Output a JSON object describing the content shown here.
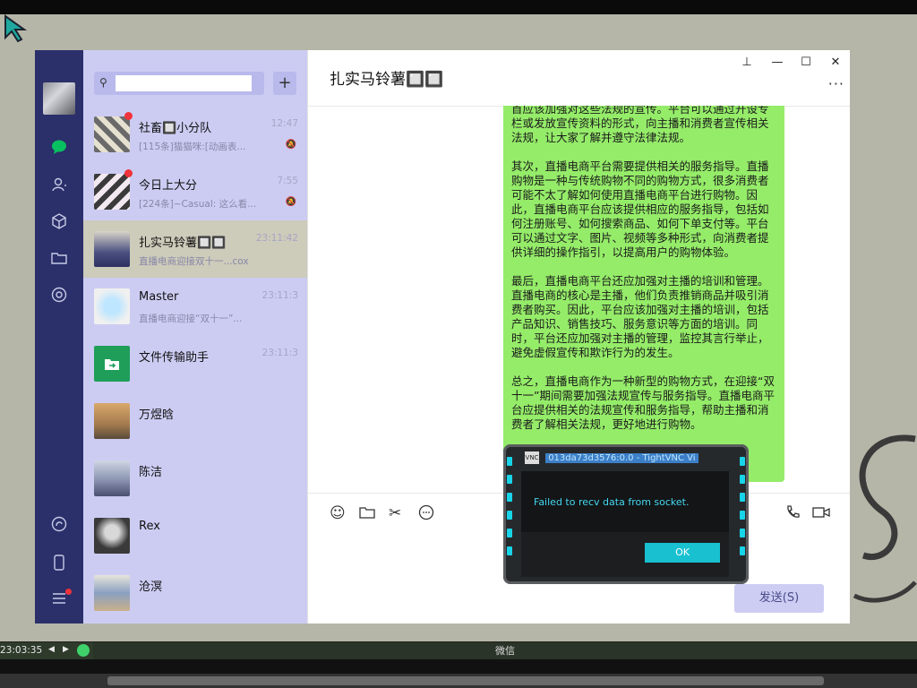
{
  "sidebar": {
    "icons": [
      "chat-icon",
      "contacts-icon",
      "cube-icon",
      "folder-icon",
      "moments-icon",
      "miniprogram-icon",
      "phone-icon",
      "menu-icon"
    ]
  },
  "list": {
    "search_placeholder": "",
    "add_label": "+",
    "chats": [
      {
        "name": "社畜🔲小分队",
        "preview": "[115条]猫猫咪:[动画表...",
        "time": "12:47",
        "muted": true,
        "unread": true
      },
      {
        "name": "今日上大分",
        "preview": "[224条]~Casual: 这么看...",
        "time": "7:55",
        "muted": true,
        "unread": true
      },
      {
        "name": "扎实马铃薯🔲🔲",
        "preview": "直播电商迎接双十一...cox",
        "time": "23:11:42",
        "muted": false,
        "unread": false,
        "active": true
      },
      {
        "name": "Master",
        "preview": "直播电商迎接“双十一”...",
        "time": "23:11:3",
        "muted": false,
        "unread": false
      },
      {
        "name": "文件传输助手",
        "preview": "",
        "time": "23:11:3",
        "muted": false,
        "unread": false
      },
      {
        "name": "万煜晗",
        "preview": "",
        "time": "",
        "muted": false,
        "unread": false
      },
      {
        "name": "陈洁",
        "preview": "",
        "time": "",
        "muted": false,
        "unread": false
      },
      {
        "name": "Rex",
        "preview": "",
        "time": "",
        "muted": false,
        "unread": false
      },
      {
        "name": "沧溟",
        "preview": "",
        "time": "",
        "muted": false,
        "unread": false
      }
    ]
  },
  "main": {
    "title": "扎实马铃薯🔲🔲",
    "window_controls": {
      "pin": "⊥",
      "min": "—",
      "max": "☐",
      "close": "✕"
    },
    "more": "···",
    "message": {
      "p0": "首应该加强对这些法规的宣传。平台可以通过开设专栏或发放宣传资料的形式，向主播和消费者宣传相关法规，让大家了解并遵守法律法规。",
      "p1": "其次，直播电商平台需要提供相关的服务指导。直播购物是一种与传统购物不同的购物方式，很多消费者可能不太了解如何使用直播电商平台进行购物。因此，直播电商平台应该提供相应的服务指导，包括如何注册账号、如何搜索商品、如何下单支付等。平台可以通过文字、图片、视频等多种形式，向消费者提供详细的操作指引，以提高用户的购物体验。",
      "p2": "最后，直播电商平台还应加强对主播的培训和管理。直播电商的核心是主播，他们负责推销商品并吸引消费者购买。因此，平台应该加强对主播的培训，包括产品知识、销售技巧、服务意识等方面的培训。同时，平台还应加强对主播的管理，监控其言行举止，避免虚假宣传和欺诈行为的发生。",
      "p3": "总之，直播电商作为一种新型的购物方式，在迎接“双十一”期间需要加强法规宣传与服务指导。直播电商平台应提供相关的法规宣传和服务指导，帮助主播和消费者了解相关法规，更好地进行购物。"
    },
    "send_label": "发送(S)"
  },
  "vnc_dialog": {
    "title": "013da73d3576:0.0 - TightVNC Vi",
    "logo": "VNC",
    "message": "Failed to recv data from socket.",
    "ok_label": "OK"
  },
  "taskbar": {
    "clock": "23:03:35",
    "task_label": "微信"
  },
  "colors": {
    "nav_bg": "#2b2f6a",
    "list_bg": "#ccccf3",
    "bubble": "#95ec69",
    "accent_cyan": "#18c0d0"
  }
}
